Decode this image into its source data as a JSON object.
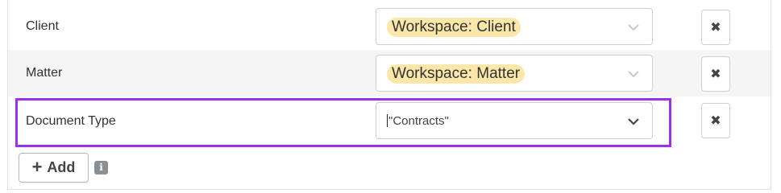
{
  "rows": [
    {
      "label": "Client",
      "value": "Workspace: Client",
      "remove_icon": "close-icon"
    },
    {
      "label": "Matter",
      "value": "Workspace: Matter",
      "remove_icon": "close-icon"
    },
    {
      "label": "Document Type",
      "value": "\"Contracts\"",
      "remove_icon": "close-icon"
    }
  ],
  "add_button": {
    "label": "Add",
    "icon": "plus-icon"
  },
  "info_icon": {
    "glyph": "i"
  },
  "colors": {
    "highlight": "#9b30f0",
    "chip": "#fbe7aa",
    "row_shade": "#f5f5f5"
  }
}
